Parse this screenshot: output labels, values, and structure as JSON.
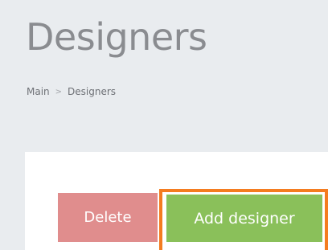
{
  "header": {
    "title": "Designers"
  },
  "breadcrumb": {
    "items": [
      "Main",
      "Designers"
    ],
    "separator": ">"
  },
  "actions": {
    "delete_label": "Delete",
    "add_label": "Add designer"
  },
  "colors": {
    "background": "#e9ecef",
    "panel": "#ffffff",
    "delete": "#e08d8d",
    "add": "#8ac05a",
    "highlight": "#f47c20"
  }
}
